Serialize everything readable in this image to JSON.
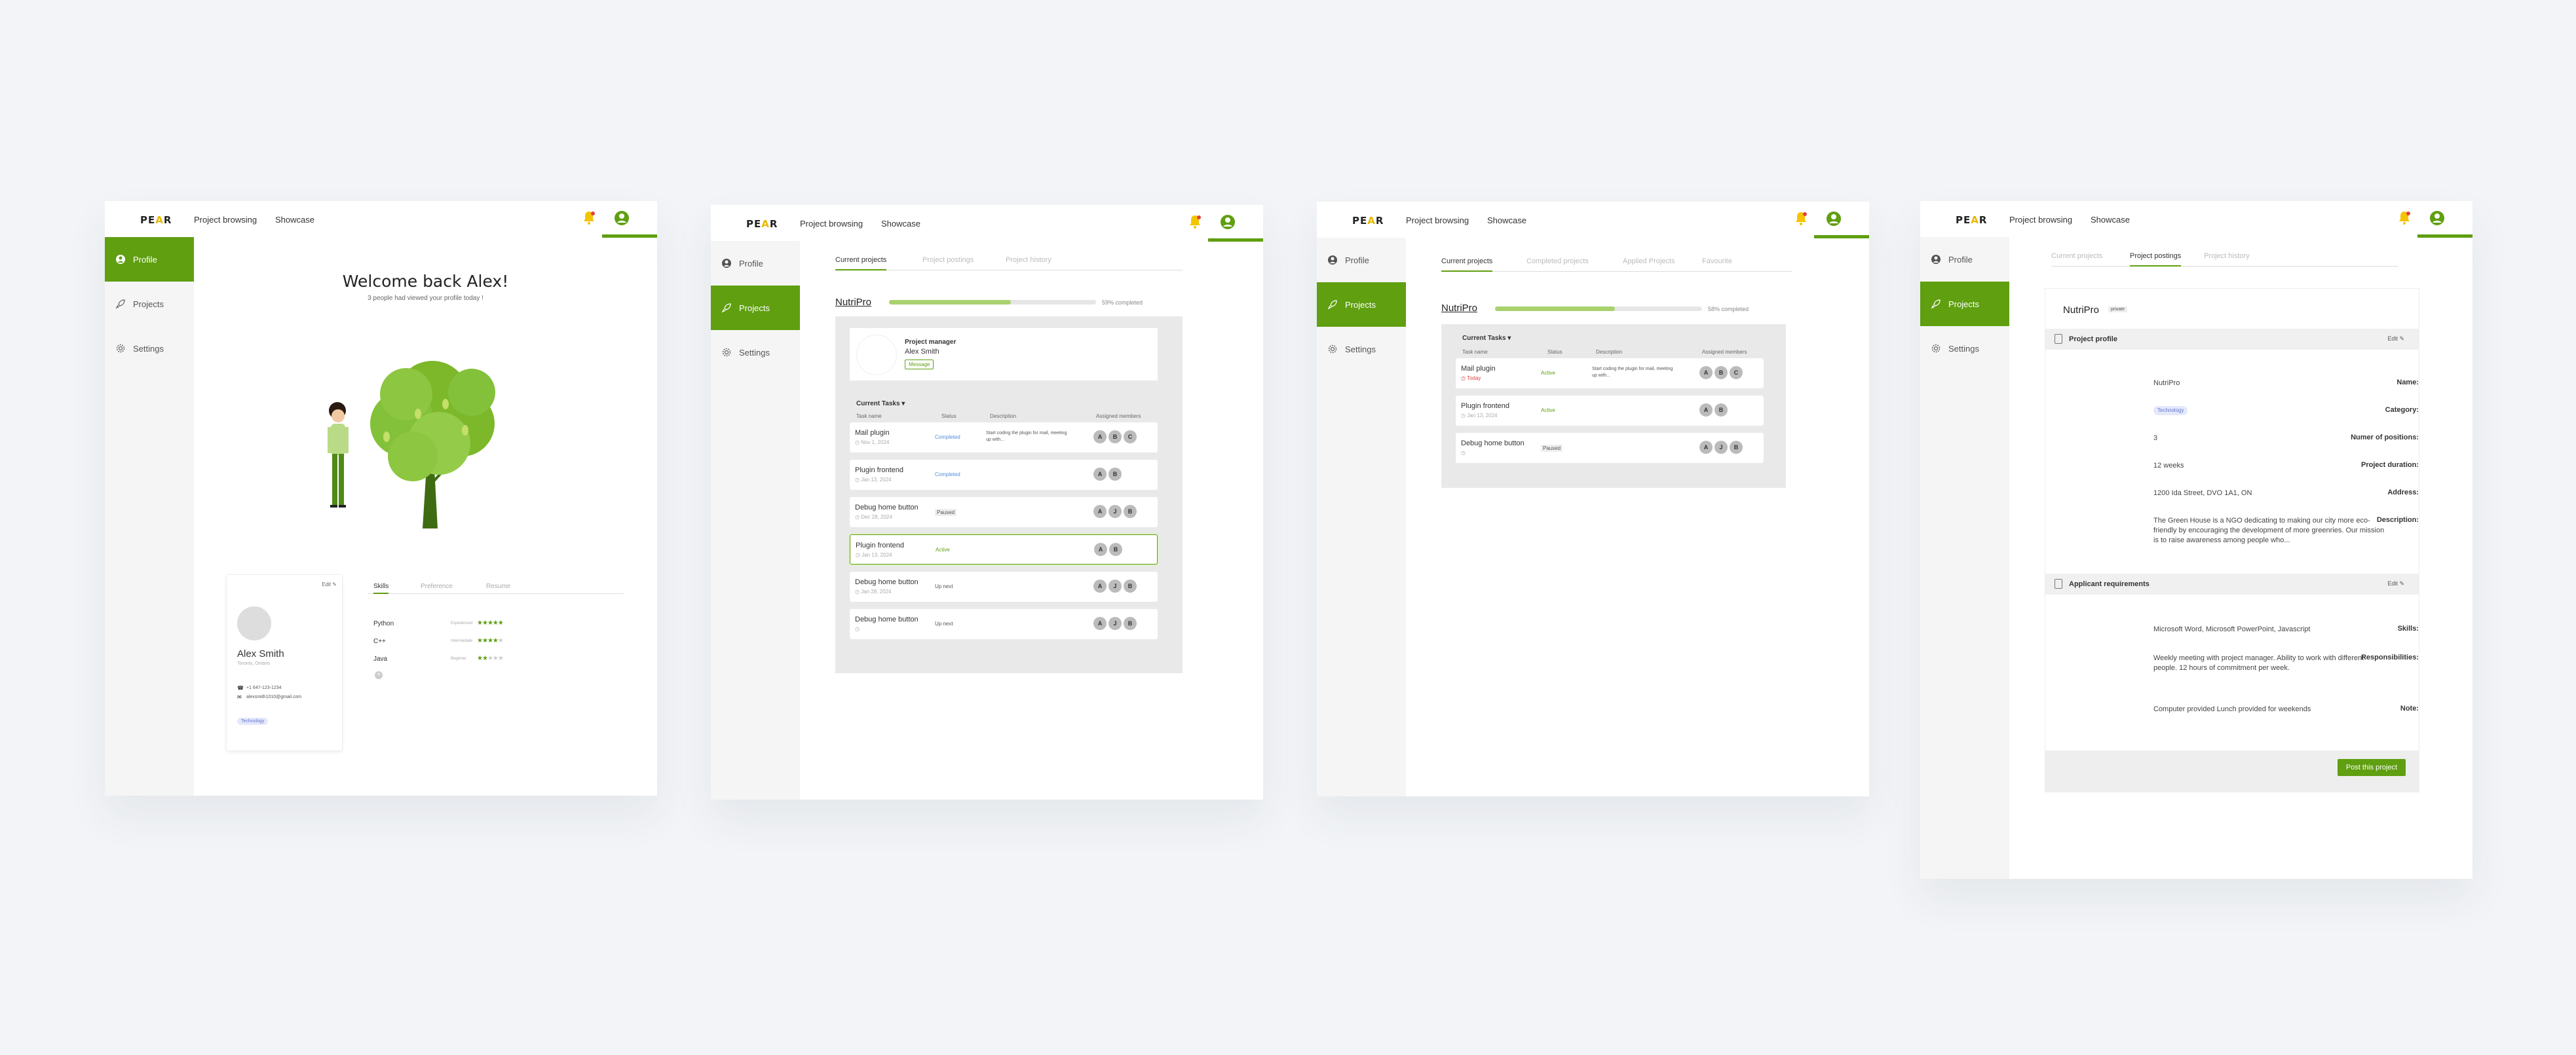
{
  "brand": {
    "logo_left": "PE",
    "logo_mid": "A",
    "logo_right": "R"
  },
  "colors": {
    "accent": "#5f9f10",
    "bell": "#f5c400",
    "background": "#f2f4f7"
  },
  "nav": {
    "project_browsing": "Project browsing",
    "showcase": "Showcase"
  },
  "sidebar": {
    "profile": "Profile",
    "projects": "Projects",
    "settings": "Settings"
  },
  "icons": {
    "bell": "notification-bell-icon",
    "user": "user-circle-icon",
    "rocket": "rocket-icon",
    "gear": "gear-icon"
  },
  "screen1": {
    "welcome": "Welcome back Alex!",
    "subtitle": "3 people had viewed your profile today !",
    "profile_card": {
      "edit": "Edit",
      "name": "Alex Smith",
      "location": "Toronto, Ontario",
      "phone": "+1 647-123-1234",
      "email": "alexsmith1010@gmail.com",
      "tag": "Technology"
    },
    "tabs": [
      "Skills",
      "Preference",
      "Resume"
    ],
    "skills": [
      {
        "name": "Python",
        "level": "Experienced",
        "stars": 5
      },
      {
        "name": "C++",
        "level": "Intermediate",
        "stars": 4
      },
      {
        "name": "Java",
        "level": "Beginner",
        "stars": 2
      }
    ]
  },
  "screen2": {
    "tabs": [
      "Current projects",
      "Project postings",
      "Project history"
    ],
    "project": "NutriPro",
    "progress": 0.59,
    "progress_label": "59% completed",
    "manager_role": "Project manager",
    "manager_name": "Alex Smith",
    "message": "Message",
    "tasks_title": "Current Tasks",
    "columns": [
      "Task name",
      "Status",
      "Description",
      "Assigned members"
    ],
    "tasks": [
      {
        "name": "Mail plugin",
        "date": "Nov 1, 2024",
        "status": "Completed",
        "desc": "Start coding the plugin for mail, meeting up with...",
        "members": [
          "A",
          "B",
          "C"
        ]
      },
      {
        "name": "Plugin frontend",
        "date": "Jan 13, 2024",
        "status": "Completed",
        "desc": "",
        "members": [
          "A",
          "B"
        ]
      },
      {
        "name": "Debug home button",
        "date": "Dec 28, 2024",
        "status": "Paused",
        "desc": "",
        "members": [
          "A",
          "J",
          "B"
        ]
      },
      {
        "name": "Plugin frontend",
        "date": "Jan 13, 2024",
        "status": "Active",
        "desc": "",
        "members": [
          "A",
          "B"
        ]
      },
      {
        "name": "Debug home button",
        "date": "Jan 28, 2024",
        "status": "Up next",
        "desc": "",
        "members": [
          "A",
          "J",
          "B"
        ]
      },
      {
        "name": "Debug home button",
        "date": "",
        "status": "Up next",
        "desc": "",
        "members": [
          "A",
          "J",
          "B"
        ]
      }
    ]
  },
  "screen3": {
    "tabs": [
      "Current projects",
      "Completed projects",
      "Applied Projects",
      "Favourite"
    ],
    "project": "NutriPro",
    "progress": 0.58,
    "progress_label": "58% completed",
    "tasks_title": "Current Tasks",
    "columns": [
      "Task name",
      "Status",
      "Description",
      "Assigned members"
    ],
    "tasks": [
      {
        "name": "Mail plugin",
        "date": "Today",
        "status": "Active",
        "desc": "Start coding the plugin for mail, meeting up with...",
        "members": [
          "A",
          "B",
          "C"
        ]
      },
      {
        "name": "Plugin frontend",
        "date": "Jan 13, 2024",
        "status": "Active",
        "desc": "",
        "members": [
          "A",
          "B"
        ]
      },
      {
        "name": "Debug home button",
        "date": "",
        "status": "Paused",
        "desc": "",
        "members": [
          "A",
          "J",
          "B"
        ]
      }
    ]
  },
  "screen4": {
    "tabs": [
      "Current projects",
      "Project postings",
      "Project history"
    ],
    "project": "NutriPro",
    "badge": "private",
    "section1_title": "Project profile",
    "section2_title": "Applicant requirements",
    "edit": "Edit",
    "fields": [
      {
        "label": "Name:",
        "value": "NutriPro"
      },
      {
        "label": "Category:",
        "value": "Technology"
      },
      {
        "label": "Numer of positions:",
        "value": "3"
      },
      {
        "label": "Project duration:",
        "value": "12 weeks"
      },
      {
        "label": "Address:",
        "value": "1200 Ida Street, DVO 1A1, ON"
      },
      {
        "label": "Description:",
        "value": "The Green House is a NGO dedicating to making our city more eco-friendly by encouraging the development of more greenries. Our mission is to raise awareness among people who..."
      }
    ],
    "requirements": [
      {
        "label": "Skills:",
        "value": "Microsoft Word, Microsoft PowerPoint, Javascript"
      },
      {
        "label": "Responsibilities:",
        "value": "Weekly meeting with project manager. Ability to work with different people. 12 hours of commitment per week."
      },
      {
        "label": "Note:",
        "value": "Computer provided Lunch provided for weekends"
      }
    ],
    "post_button": "Post this project"
  }
}
